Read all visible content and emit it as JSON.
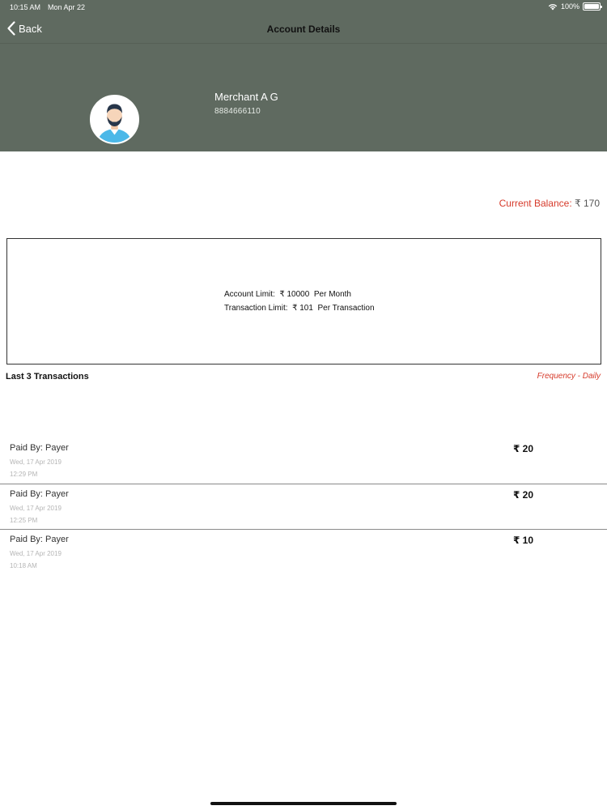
{
  "status_bar": {
    "time": "10:15 AM",
    "date": "Mon Apr 22",
    "battery": "100%"
  },
  "nav": {
    "back_label": "Back",
    "title": "Account Details"
  },
  "merchant": {
    "name": "Merchant A G",
    "phone": "8884666110"
  },
  "balance": {
    "label": "Current Balance:",
    "value": "₹ 170"
  },
  "limits": {
    "account_limit": "Account Limit:  ₹ 10000  Per Month",
    "transaction_limit": "Transaction Limit:  ₹ 101  Per Transaction"
  },
  "transactions": {
    "title": "Last 3 Transactions",
    "frequency": "Frequency - Daily",
    "items": [
      {
        "payer": "Paid By: Payer",
        "date": "Wed, 17 Apr 2019",
        "time": "12:29 PM",
        "amount": "₹ 20"
      },
      {
        "payer": "Paid By: Payer",
        "date": "Wed, 17 Apr 2019",
        "time": "12:25 PM",
        "amount": "₹ 20"
      },
      {
        "payer": "Paid By: Payer",
        "date": "Wed, 17 Apr 2019",
        "time": "10:18 AM",
        "amount": "₹ 10"
      }
    ]
  },
  "colors": {
    "header_bg": "#5f6a60",
    "accent_red": "#d63a2a"
  },
  "icons": [
    "wifi-icon",
    "battery-icon",
    "chevron-left-icon",
    "avatar-icon"
  ]
}
